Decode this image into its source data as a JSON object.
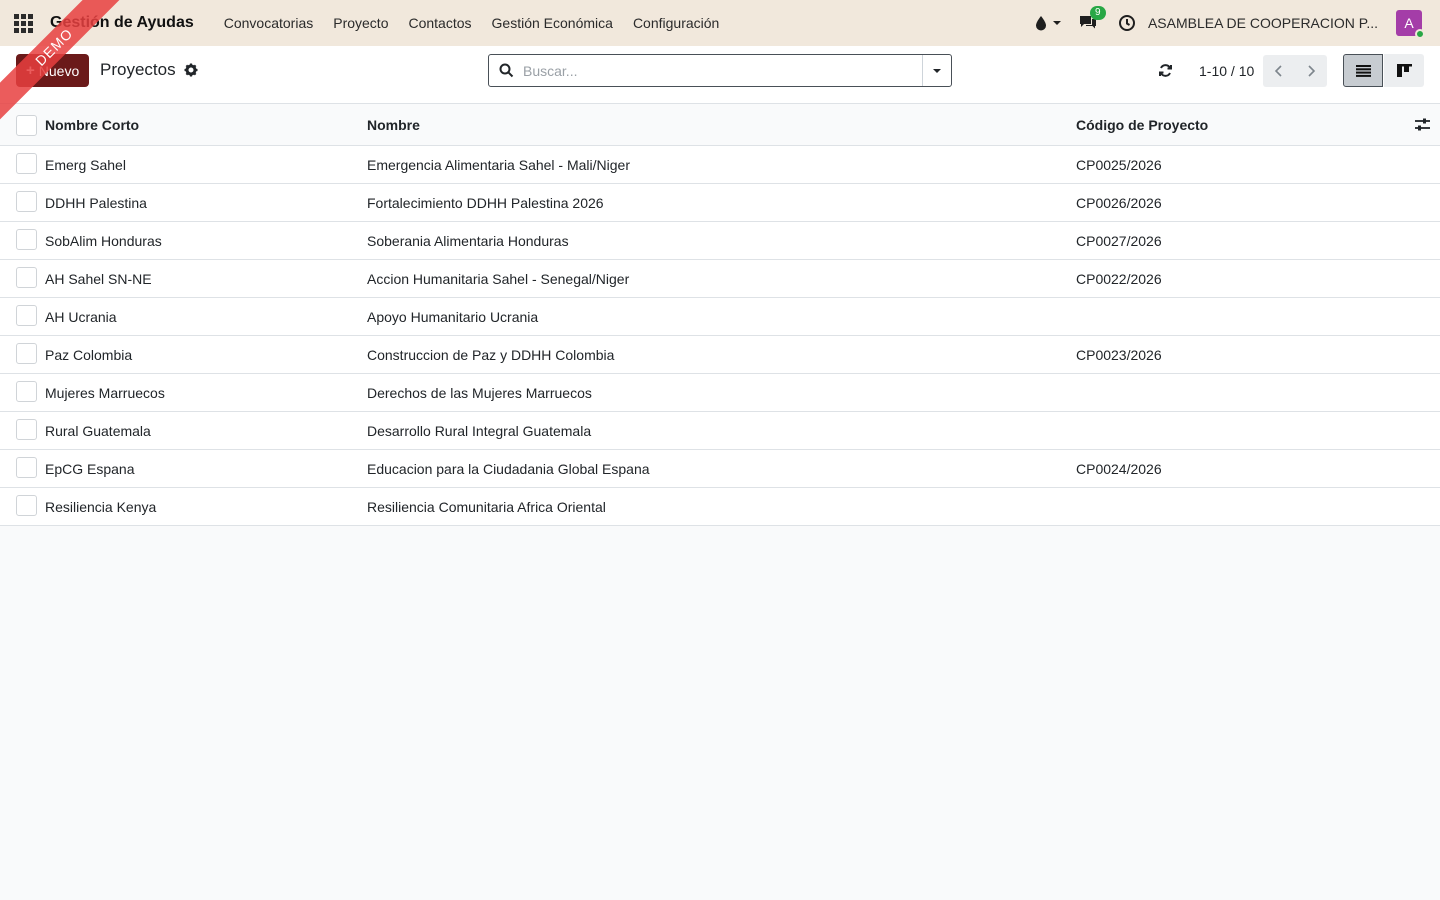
{
  "navbar": {
    "brand": "Gestión de Ayudas",
    "menu": [
      "Convocatorias",
      "Proyecto",
      "Contactos",
      "Gestión Económica",
      "Configuración"
    ],
    "messages_count": "9",
    "company": "ASAMBLEA DE COOPERACION P...",
    "avatar_letter": "A"
  },
  "ribbon": "DEMO",
  "control": {
    "new_label": "Nuevo",
    "breadcrumb": "Proyectos",
    "search_placeholder": "Buscar...",
    "pager": "1-10 / 10"
  },
  "table": {
    "columns": [
      "Nombre Corto",
      "Nombre",
      "Código de Proyecto"
    ],
    "rows": [
      [
        "Emerg Sahel",
        "Emergencia Alimentaria Sahel - Mali/Niger",
        "CP0025/2026"
      ],
      [
        "DDHH Palestina",
        "Fortalecimiento DDHH Palestina 2026",
        "CP0026/2026"
      ],
      [
        "SobAlim Honduras",
        "Soberania Alimentaria Honduras",
        "CP0027/2026"
      ],
      [
        "AH Sahel SN-NE",
        "Accion Humanitaria Sahel - Senegal/Niger",
        "CP0022/2026"
      ],
      [
        "AH Ucrania",
        "Apoyo Humanitario Ucrania",
        ""
      ],
      [
        "Paz Colombia",
        "Construccion de Paz y DDHH Colombia",
        "CP0023/2026"
      ],
      [
        "Mujeres Marruecos",
        "Derechos de las Mujeres Marruecos",
        ""
      ],
      [
        "Rural Guatemala",
        "Desarrollo Rural Integral Guatemala",
        ""
      ],
      [
        "EpCG Espana",
        "Educacion para la Ciudadania Global Espana",
        "CP0024/2026"
      ],
      [
        "Resiliencia Kenya",
        "Resiliencia Comunitaria Africa Oriental",
        ""
      ]
    ]
  },
  "colors": {
    "navbar_bg": "#f1e8dc",
    "primary": "#6b1a1a",
    "badge": "#28a745",
    "avatar": "#a43da8",
    "ribbon": "#e83f3f"
  },
  "icons": [
    "apps-grid-icon",
    "theme-drop-icon",
    "caret-down-icon",
    "chat-icon",
    "clock-icon",
    "gear-icon",
    "search-icon",
    "refresh-icon",
    "chevron-left-icon",
    "chevron-right-icon",
    "list-view-icon",
    "kanban-view-icon",
    "column-options-icon"
  ]
}
